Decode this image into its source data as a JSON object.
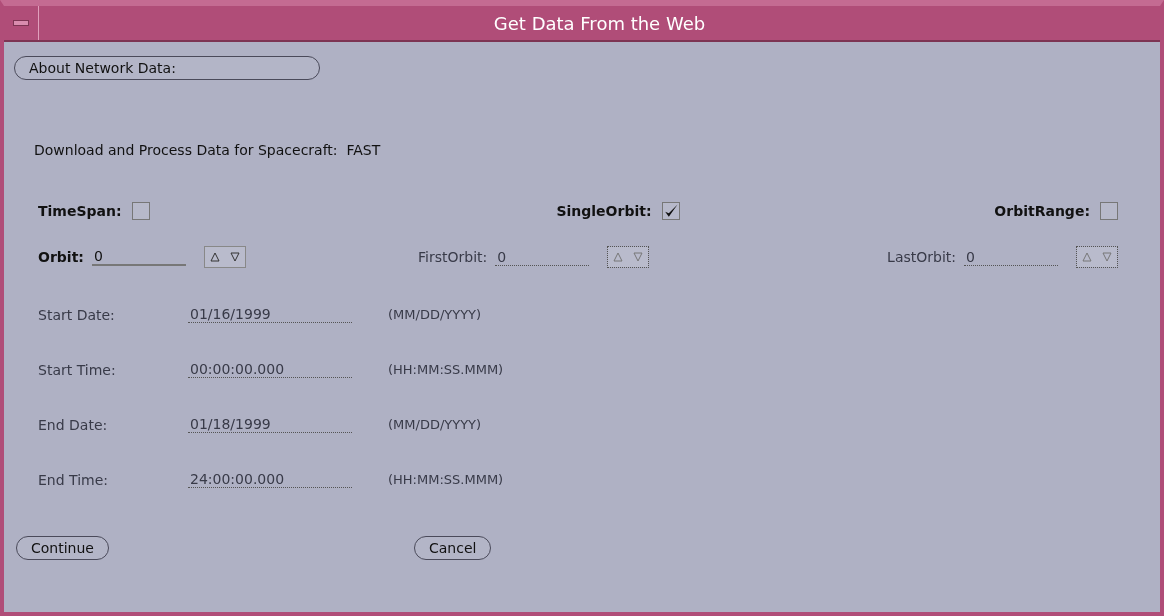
{
  "window": {
    "title": "Get Data From the Web"
  },
  "about_button": "About Network Data:",
  "description": "Download and Process Data for Spacecraft:  FAST",
  "modes": [
    {
      "label": "TimeSpan:",
      "checked": false
    },
    {
      "label": "SingleOrbit:",
      "checked": true
    },
    {
      "label": "OrbitRange:",
      "checked": false
    }
  ],
  "orbit_fields": [
    {
      "label": "Orbit:",
      "value": "0",
      "disabled": false
    },
    {
      "label": "FirstOrbit:",
      "value": "0",
      "disabled": true
    },
    {
      "label": "LastOrbit:",
      "value": "0",
      "disabled": true
    }
  ],
  "time_fields": [
    {
      "label": "Start Date:",
      "value": "01/16/1999",
      "format": "(MM/DD/YYYY)",
      "disabled": true
    },
    {
      "label": "Start Time:",
      "value": "00:00:00.000",
      "format": "(HH:MM:SS.MMM)",
      "disabled": true
    },
    {
      "label": "End Date:",
      "value": "01/18/1999",
      "format": "(MM/DD/YYYY)",
      "disabled": true
    },
    {
      "label": "End Time:",
      "value": "24:00:00.000",
      "format": "(HH:MM:SS.MMM)",
      "disabled": true
    }
  ],
  "buttons": [
    "Continue",
    "Cancel"
  ]
}
